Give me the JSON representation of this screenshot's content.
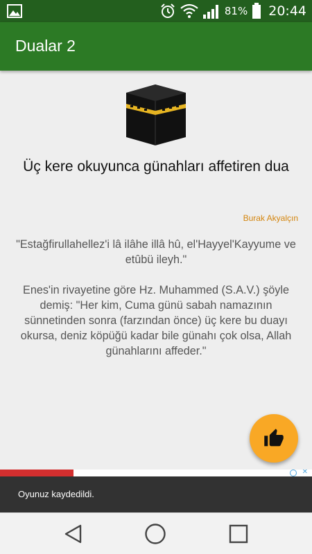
{
  "status_bar": {
    "battery_percent": "81%",
    "time": "20:44",
    "icons": [
      "image-icon",
      "alarm-icon",
      "wifi-icon",
      "signal-icon",
      "battery-icon"
    ]
  },
  "app_bar": {
    "title": "Dualar 2",
    "color": "#2c7a25"
  },
  "content": {
    "image_icon": "kaaba-icon",
    "heading": "Üç kere okuyunca günahları affetiren dua",
    "author": "Burak Akyalçın",
    "dua_text": "\"Estağfirullahellez'i lâ ilâhe illâ hû, el'Hayyel'Kayyume ve etûbü ileyh.\"",
    "description": "Enes'in rivayetine göre Hz. Muhammed (S.A.V.) şöyle demiş: \"Her kim, Cuma günü sabah namazının sünnetinden sonra (farzından önce) üç kere bu duayı okursa, deniz köpüğü kadar bile günahı çok olsa, Allah günahlarını affeder.\""
  },
  "fab": {
    "icon": "thumbs-up-icon",
    "color": "#f9a825"
  },
  "snackbar": {
    "message": "Oyunuz kaydedildi."
  },
  "nav_bar": {
    "buttons": [
      "back-icon",
      "home-icon",
      "recents-icon"
    ]
  }
}
